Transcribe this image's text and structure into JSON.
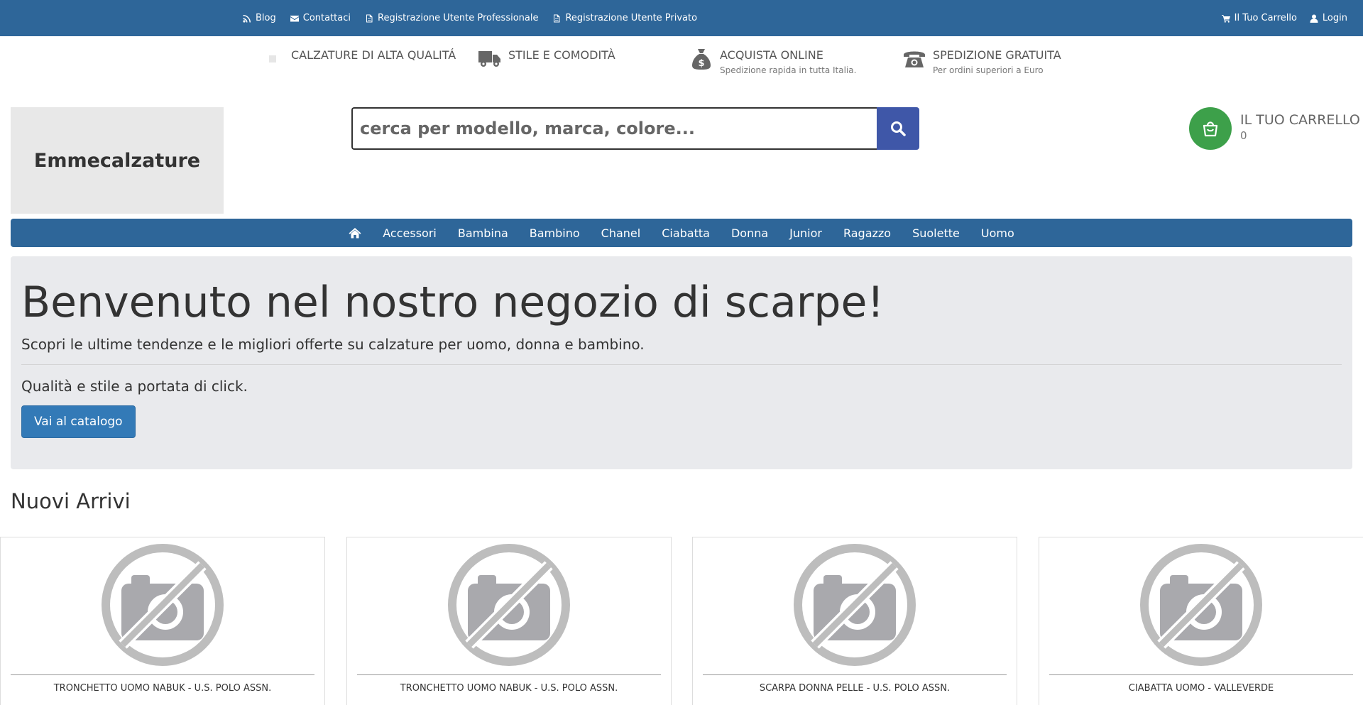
{
  "topbar": {
    "links": [
      {
        "label": "Blog",
        "icon": "rss-icon"
      },
      {
        "label": "Contattaci",
        "icon": "envelope-icon"
      },
      {
        "label": "Registrazione Utente Professionale",
        "icon": "document-icon"
      },
      {
        "label": "Registrazione Utente Privato",
        "icon": "document-icon"
      }
    ],
    "cart_label": "Il Tuo Carrello",
    "login_label": "Login"
  },
  "features": [
    {
      "title": "Calzature di alta qualitá",
      "subtitle": "",
      "icon": "image-placeholder-icon"
    },
    {
      "title": "Stile e comodità",
      "subtitle": "",
      "icon": "truck-icon"
    },
    {
      "title": "Acquista online",
      "subtitle": "Spedizione rapida in tutta Italia.",
      "icon": "money-bag-icon"
    },
    {
      "title": "Spedizione gratuita",
      "subtitle": "Per ordini superiori a Euro",
      "icon": "telephone-icon"
    }
  ],
  "header": {
    "logo_text": "Emmecalzature",
    "search_placeholder": "cerca per modello, marca, colore...",
    "cart_title": "Il Tuo Carrello",
    "cart_count": "0"
  },
  "nav": {
    "items": [
      "Accessori",
      "Bambina",
      "Bambino",
      "Chanel",
      "Ciabatta",
      "Donna",
      "Junior",
      "Ragazzo",
      "Suolette",
      "Uomo"
    ]
  },
  "hero": {
    "title": "Benvenuto nel nostro negozio di scarpe!",
    "lead": "Scopri le ultime tendenze e le migliori offerte su calzature per uomo, donna e bambino.",
    "text": "Qualità e stile a portata di click.",
    "button": "Vai al catalogo"
  },
  "new_arrivals": {
    "title": "Nuovi Arrivi",
    "products": [
      {
        "name": "TRONCHETTO UOMO NABUK - U.S. POLO ASSN."
      },
      {
        "name": "TRONCHETTO UOMO NABUK - U.S. POLO ASSN."
      },
      {
        "name": "SCARPA DONNA PELLE - U.S. POLO ASSN."
      },
      {
        "name": "CIABATTA UOMO - VALLEVERDE"
      }
    ]
  },
  "colors": {
    "primary_blue": "#2e6699",
    "search_button": "#3f57a8",
    "cart_green": "#3da04a",
    "button_blue": "#337ab7"
  }
}
